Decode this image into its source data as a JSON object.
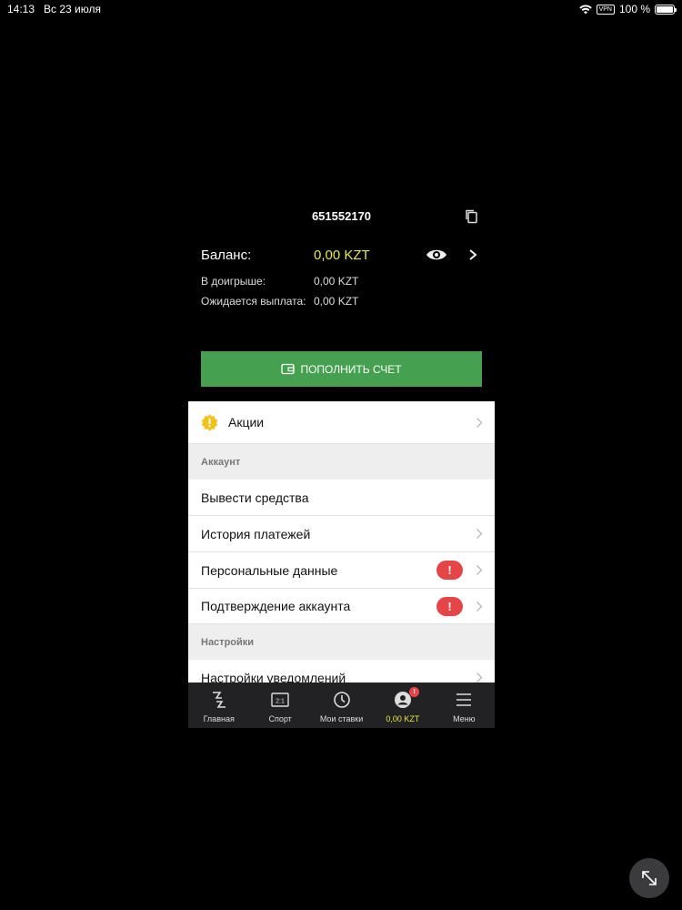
{
  "status_bar": {
    "time": "14:13",
    "date": "Вс 23 июля",
    "vpn": "VPN",
    "battery": "100 %"
  },
  "account": {
    "id": "651552170",
    "balance_label": "Баланс:",
    "balance_value": "0,00 KZT",
    "rows": [
      {
        "label": "В доигрыше:",
        "value": "0,00 KZT"
      },
      {
        "label": "Ожидается выплата:",
        "value": "0,00 KZT"
      }
    ]
  },
  "deposit_button": "ПОПОЛНИТЬ СЧЕТ",
  "menu": {
    "promo": "Акции",
    "section_account": "Аккаунт",
    "withdraw": "Вывести средства",
    "payment_history": "История платежей",
    "personal_data": "Персональные данные",
    "account_verification": "Подтверждение аккаунта",
    "alert_mark": "!",
    "section_settings": "Настройки",
    "notification_settings": "Настройки уведомлений"
  },
  "tabbar": {
    "home": "Главная",
    "sport": "Спорт",
    "sport_icon_text": "2:1",
    "my_bets": "Мои ставки",
    "balance": "0,00 KZT",
    "badge": "!",
    "menu": "Меню"
  },
  "colors": {
    "accent": "#e7e93f",
    "deposit_green": "#45a050",
    "alert_red": "#e64547",
    "tabbar_bg": "#222224"
  }
}
